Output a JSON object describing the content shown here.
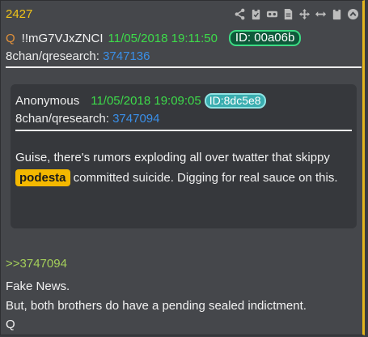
{
  "post": {
    "number": "2427",
    "author_mark": "Q",
    "tripcode": "!!mG7VJxZNCI",
    "datetime": "11/05/2018 19:11:50",
    "id_label": "ID: 00a06b",
    "board": "8chan/qresearch:",
    "post_link": "3747136",
    "toolbar_icons": [
      "share-icon",
      "clipboard-check-icon",
      "vr-goggles-icon",
      "document-icon",
      "move-icon",
      "resize-horizontal-icon",
      "clipboard-icon",
      "collapse-up-icon"
    ]
  },
  "quoted": {
    "name": "Anonymous",
    "datetime": "11/05/2018 19:09:05",
    "id_label": "ID:8dc5e8",
    "board": "8chan/qresearch:",
    "post_link": "3747094",
    "body_before": "Guise, there's rumors exploding all over twatter that skippy ",
    "keyword": "podesta",
    "body_after": " committed suicide. Digging for real sauce on this."
  },
  "reply": {
    "reference": ">>3747094",
    "lines": [
      "Fake News.",
      "But, both brothers do have a pending sealed indictment.",
      "Q"
    ]
  },
  "colors": {
    "accent": "#e3b51d",
    "date_green": "#3ddc4a",
    "link_blue": "#3a8fe8",
    "keyword_bg": "#f4b800",
    "reply_green": "#a4cf5a"
  }
}
